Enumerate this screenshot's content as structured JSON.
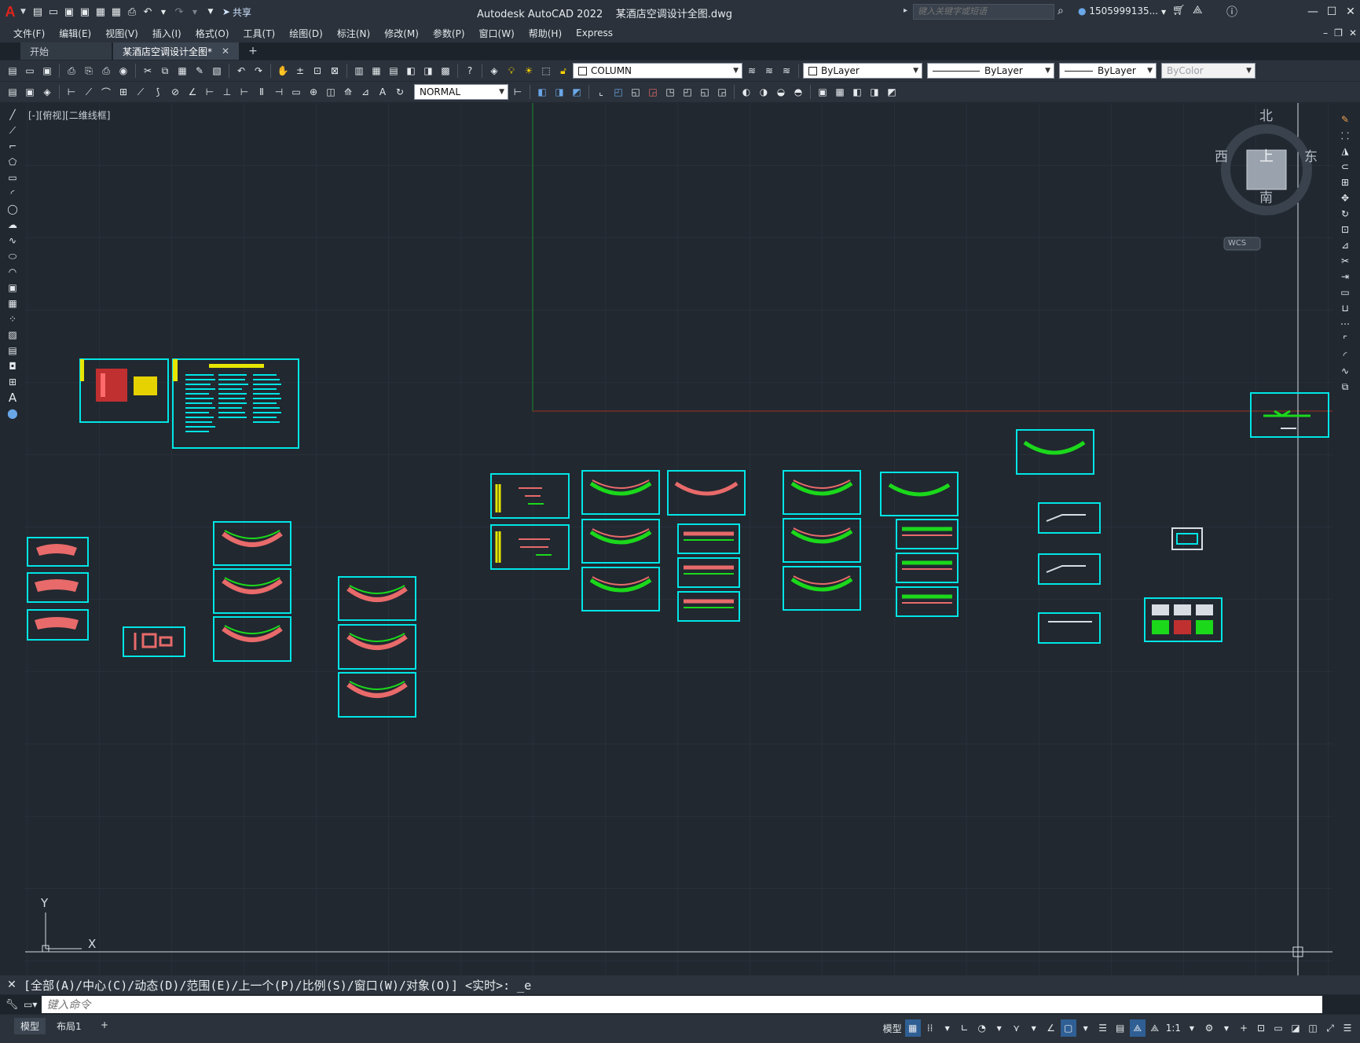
{
  "app": {
    "title": "Autodesk AutoCAD 2022",
    "file": "某酒店空调设计全图.dwg",
    "share": "共享",
    "search_placeholder": "键入关键字或短语",
    "user": "1505999135..."
  },
  "menu": [
    "文件(F)",
    "编辑(E)",
    "视图(V)",
    "插入(I)",
    "格式(O)",
    "工具(T)",
    "绘图(D)",
    "标注(N)",
    "修改(M)",
    "参数(P)",
    "窗口(W)",
    "帮助(H)",
    "Express"
  ],
  "tabs": {
    "start": "开始",
    "drawing": "某酒店空调设计全图*"
  },
  "properties": {
    "layer": "COLUMN",
    "color": "ByLayer",
    "linetype": "ByLayer",
    "lineweight": "ByLayer",
    "plotstyle": "ByColor",
    "dimstyle": "NORMAL"
  },
  "viewport_label": "[-][俯视][二维线框]",
  "viewcube": {
    "north": "北",
    "south": "南",
    "east": "东",
    "west": "西",
    "top": "上",
    "wcs": "WCS"
  },
  "ucs": {
    "x": "X",
    "y": "Y"
  },
  "command": {
    "history": "[全部(A)/中心(C)/动态(D)/范围(E)/上一个(P)/比例(S)/窗口(W)/对象(O)] <实时>: _e",
    "placeholder": "键入命令"
  },
  "layouts": {
    "model": "模型",
    "layout1": "布局1"
  },
  "status": {
    "model": "模型",
    "scale": "1:1"
  },
  "colors": {
    "background": "#212830",
    "frame": "#00e5e5",
    "accent": "#2f5f94",
    "x_axis": "#a03020",
    "y_axis": "#1b8a2a"
  }
}
